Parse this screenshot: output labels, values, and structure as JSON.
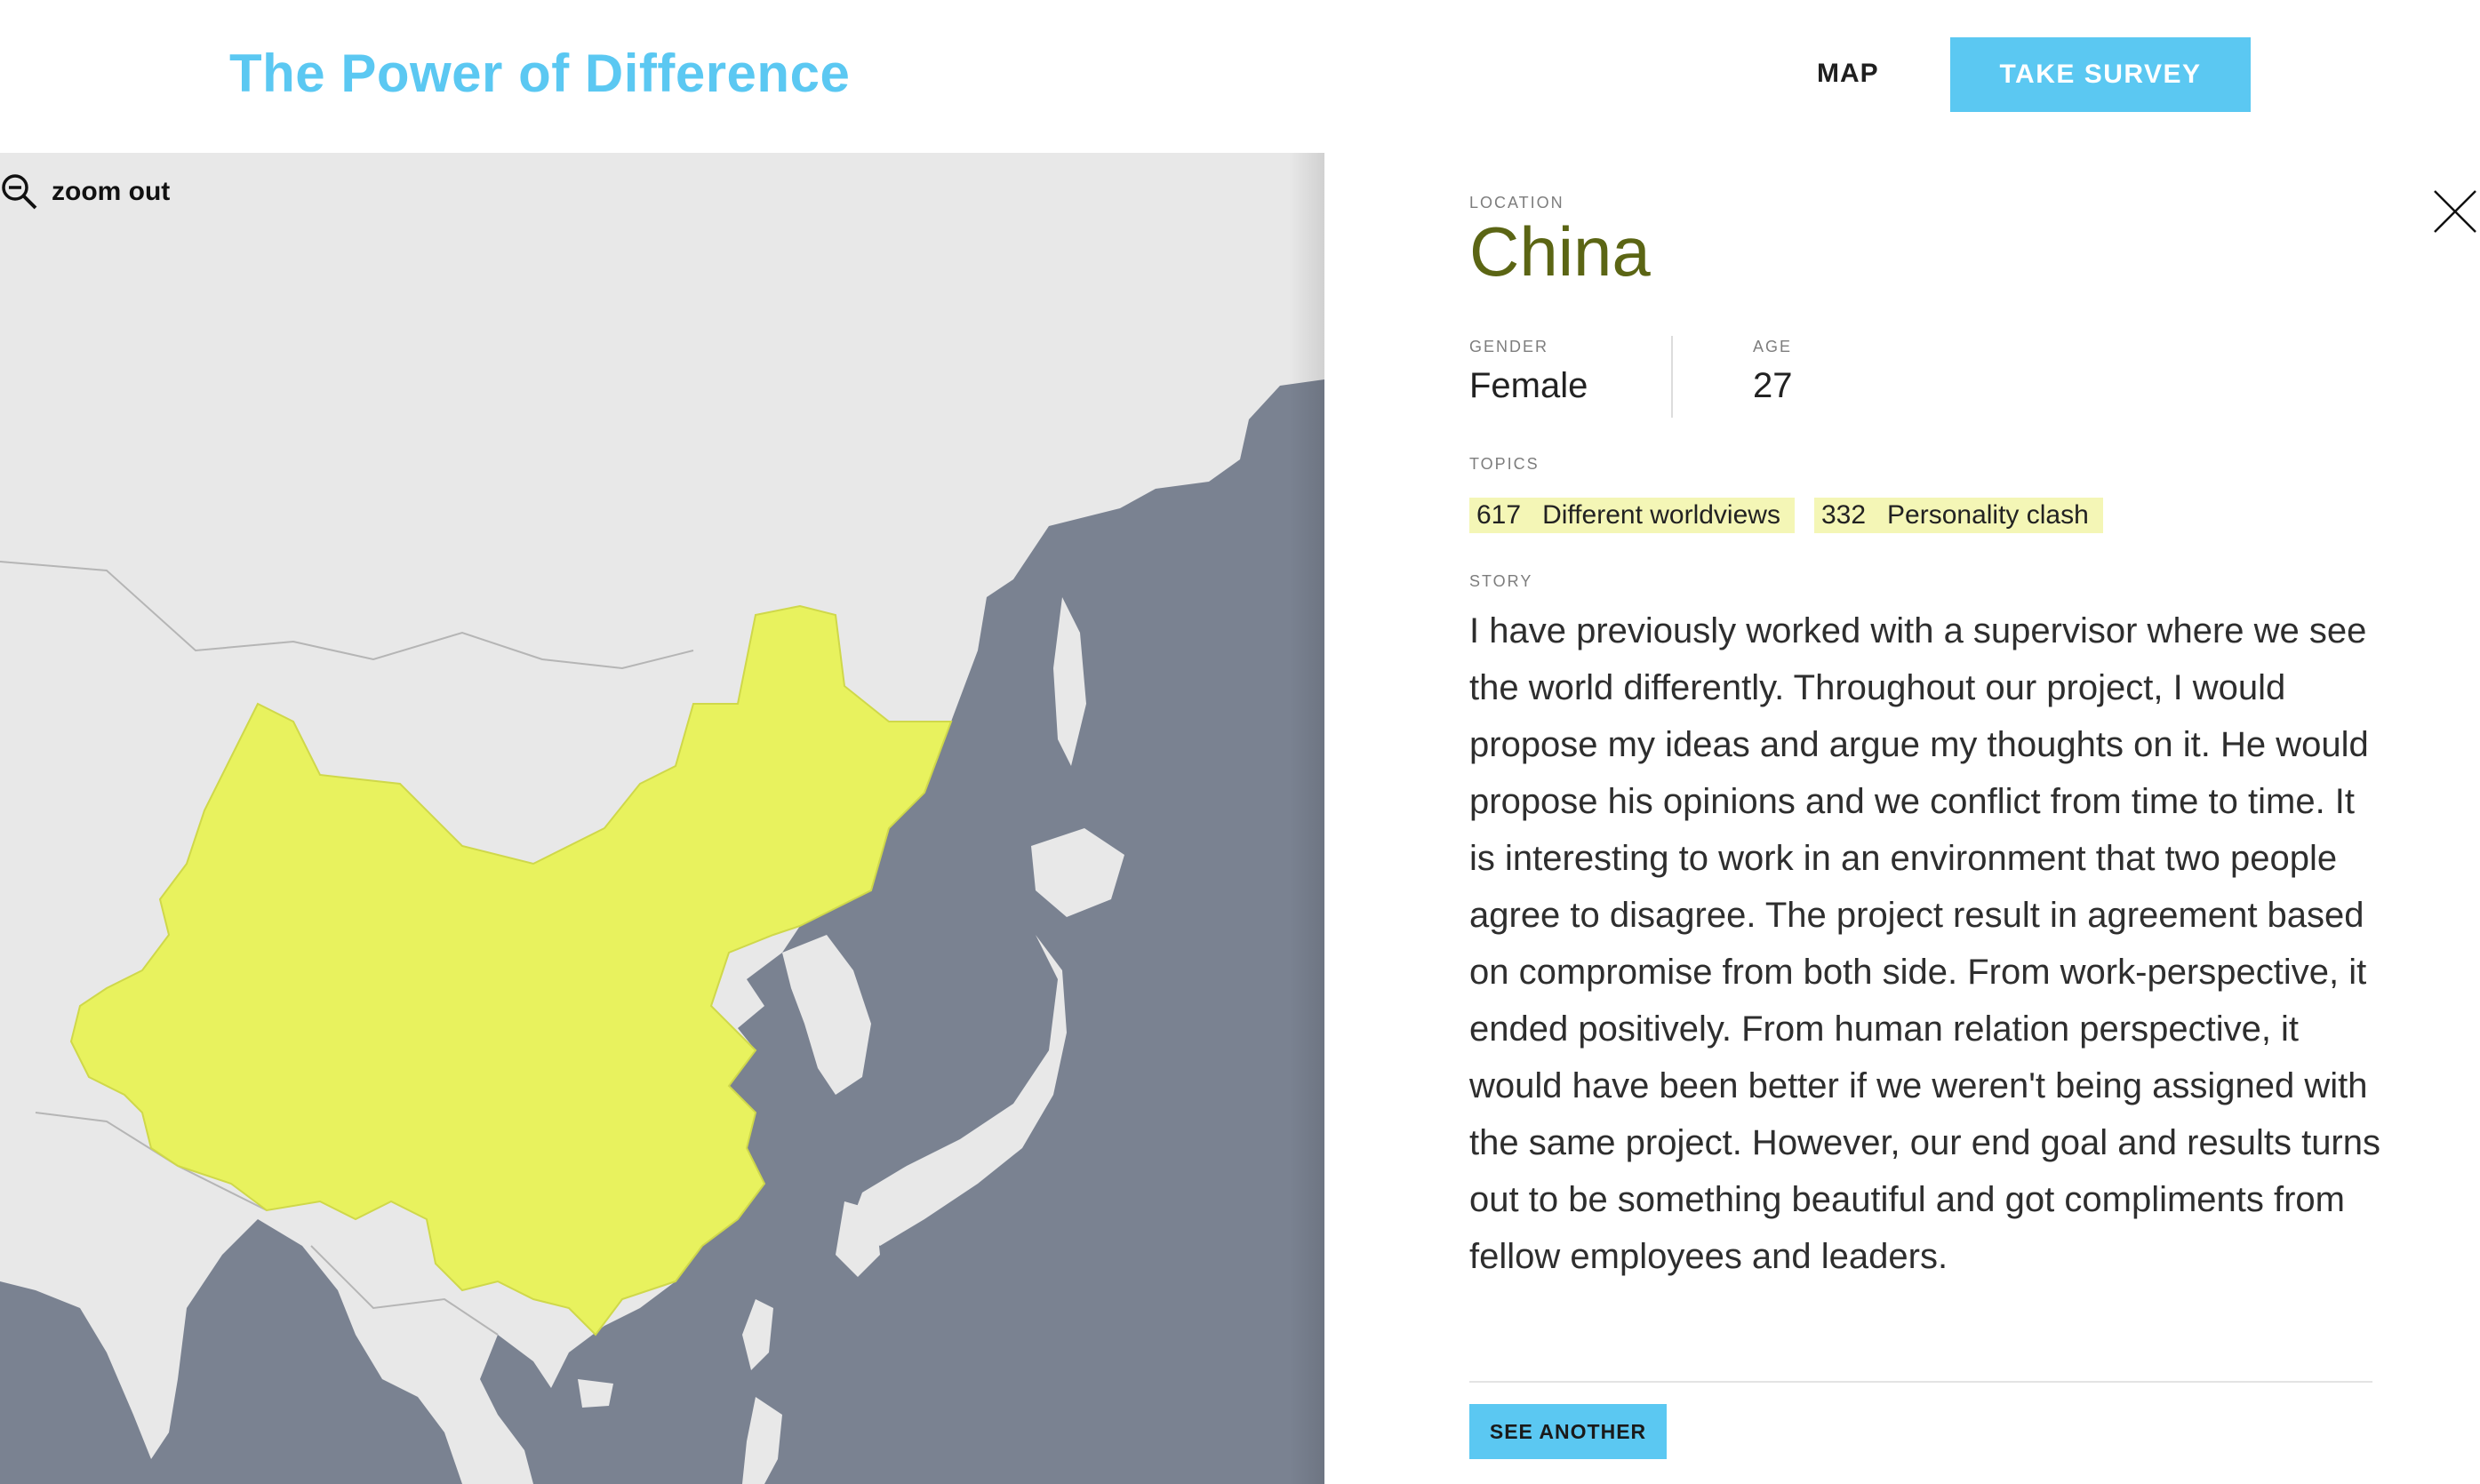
{
  "header": {
    "brand": "The Power of Difference",
    "nav_map": "MAP",
    "survey_button": "TAKE SURVEY"
  },
  "map": {
    "zoom_label": "zoom out",
    "zoom_icon": "zoom-out-icon",
    "highlighted_country": "China",
    "colors": {
      "sea": "#7a8291",
      "land": "#e8e8e8",
      "highlight": "#e8f25e"
    }
  },
  "detail": {
    "close_icon": "close-icon",
    "location_label": "LOCATION",
    "location_value": "China",
    "gender_label": "GENDER",
    "gender_value": "Female",
    "age_label": "AGE",
    "age_value": "27",
    "topics_label": "TOPICS",
    "topics": [
      {
        "count": "617",
        "name": "Different worldviews"
      },
      {
        "count": "332",
        "name": "Personality clash"
      }
    ],
    "story_label": "STORY",
    "story_text": "I have previously worked with a supervisor where we see the world differently. Throughout our project, I would propose my ideas and argue my thoughts on it. He would propose his opinions and we conflict from time to time. It is interesting to work in an environment that two people agree to disagree. The project result in agreement based on compromise from both side. From work-perspective, it ended positively. From human relation perspective, it would have been better if we weren't being assigned with the same project. However, our end goal and results turns out to be something beautiful and got compliments from fellow employees and leaders.",
    "see_another_button": "SEE ANOTHER"
  },
  "colors": {
    "accent": "#5bc8f2",
    "location_text": "#5b6514",
    "chip_bg": "#f4f6b6"
  }
}
